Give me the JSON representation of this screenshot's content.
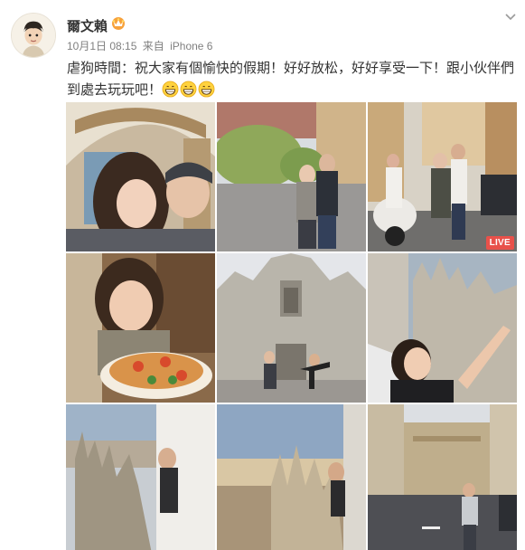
{
  "post": {
    "username": "爾文賴",
    "date": "10月1日 08:15",
    "source_prefix": "来自",
    "source": "iPhone 6",
    "text": "虐狗時間：祝大家有個愉快的假期！好好放松，好好享受一下！跟小伙伴們到處去玩玩吧！",
    "emoji_count": 3
  },
  "icons": {
    "badge": "vip-crown-icon",
    "menu": "chevron-down-icon",
    "emoji": "grinning-face-icon"
  },
  "photos": [
    {
      "id": "couple-selfie-arcade"
    },
    {
      "id": "couple-standing-park"
    },
    {
      "id": "group-with-scooter",
      "badge": "LIVE"
    },
    {
      "id": "woman-with-pizza"
    },
    {
      "id": "duomo-facade-jump"
    },
    {
      "id": "woman-rooftop-spires"
    },
    {
      "id": "man-rooftop-skyline"
    },
    {
      "id": "rooftop-sunset-city"
    },
    {
      "id": "man-walking-street"
    }
  ],
  "colors": {
    "live_badge": "#e8514a",
    "meta_text": "#808080",
    "main_text": "#333333"
  }
}
